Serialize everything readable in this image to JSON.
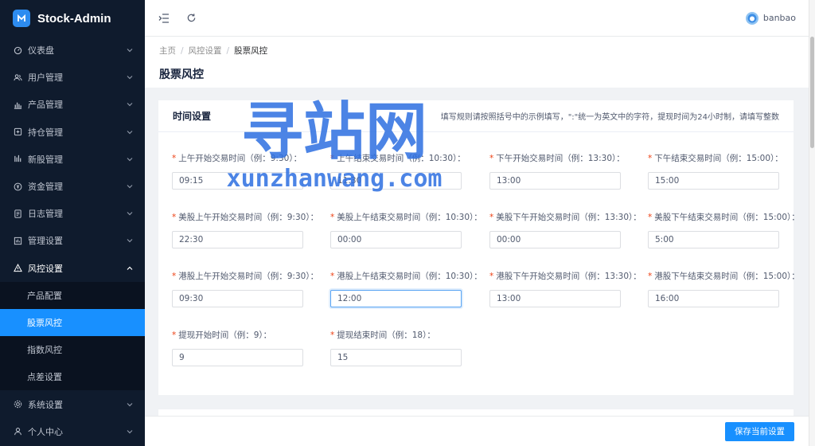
{
  "app": {
    "name": "Stock-Admin"
  },
  "colors": {
    "sidebar_bg": "#0f1b2d",
    "accent": "#1890ff",
    "required": "#ed4014",
    "watermark": "#2d6fe0"
  },
  "sidebar": {
    "items": [
      {
        "label": "仪表盘",
        "icon": "dashboard-icon"
      },
      {
        "label": "用户管理",
        "icon": "users-icon"
      },
      {
        "label": "产品管理",
        "icon": "chart-icon"
      },
      {
        "label": "持仓管理",
        "icon": "position-icon"
      },
      {
        "label": "新股管理",
        "icon": "ipo-icon"
      },
      {
        "label": "资金管理",
        "icon": "money-icon"
      },
      {
        "label": "日志管理",
        "icon": "log-icon"
      },
      {
        "label": "管理设置",
        "icon": "admin-icon"
      },
      {
        "label": "风控设置",
        "icon": "warning-icon"
      }
    ],
    "risk_submenu": [
      {
        "label": "产品配置"
      },
      {
        "label": "股票风控",
        "active": true
      },
      {
        "label": "指数风控"
      },
      {
        "label": "点差设置"
      }
    ],
    "items_after": [
      {
        "label": "系统设置",
        "icon": "gear-icon"
      },
      {
        "label": "个人中心",
        "icon": "person-icon"
      }
    ]
  },
  "header": {
    "username": "banbao"
  },
  "breadcrumb": [
    "主页",
    "风控设置",
    "股票风控"
  ],
  "page_title": "股票风控",
  "card": {
    "title": "时间设置",
    "note": "填写规则请按照括号中的示例填写，\":\"统一为英文中的字符，提现时间为24小时制，请填写整数",
    "fields": [
      {
        "label": "上午开始交易时间（例：9:30）：",
        "value": "09:15"
      },
      {
        "label": "上午结束交易时间（例：10:30）：",
        "value": "11:30"
      },
      {
        "label": "下午开始交易时间（例：13:30）：",
        "value": "13:00"
      },
      {
        "label": "下午结束交易时间（例：15:00）：",
        "value": "15:00"
      },
      {
        "label": "美股上午开始交易时间（例：9:30）：",
        "value": "22:30"
      },
      {
        "label": "美股上午结束交易时间（例：10:30）：",
        "value": "00:00"
      },
      {
        "label": "美股下午开始交易时间（例：13:30）：",
        "value": "00:00"
      },
      {
        "label": "美股下午结束交易时间（例：15:00）：",
        "value": "5:00"
      },
      {
        "label": "港股上午开始交易时间（例：9:30）：",
        "value": "09:30"
      },
      {
        "label": "港股上午结束交易时间（例：10:30）：",
        "value": "12:00"
      },
      {
        "label": "港股下午开始交易时间（例：13:30）：",
        "value": "13:00"
      },
      {
        "label": "港股下午结束交易时间（例：15:00）：",
        "value": "16:00"
      },
      {
        "label": "提现开始时间（例：9）：",
        "value": "9"
      },
      {
        "label": "提现结束时间（例：18）：",
        "value": "15"
      }
    ]
  },
  "footer": {
    "save_label": "保存当前设置"
  },
  "watermark": {
    "title": "寻站网",
    "url": "xunzhanwang.com"
  }
}
